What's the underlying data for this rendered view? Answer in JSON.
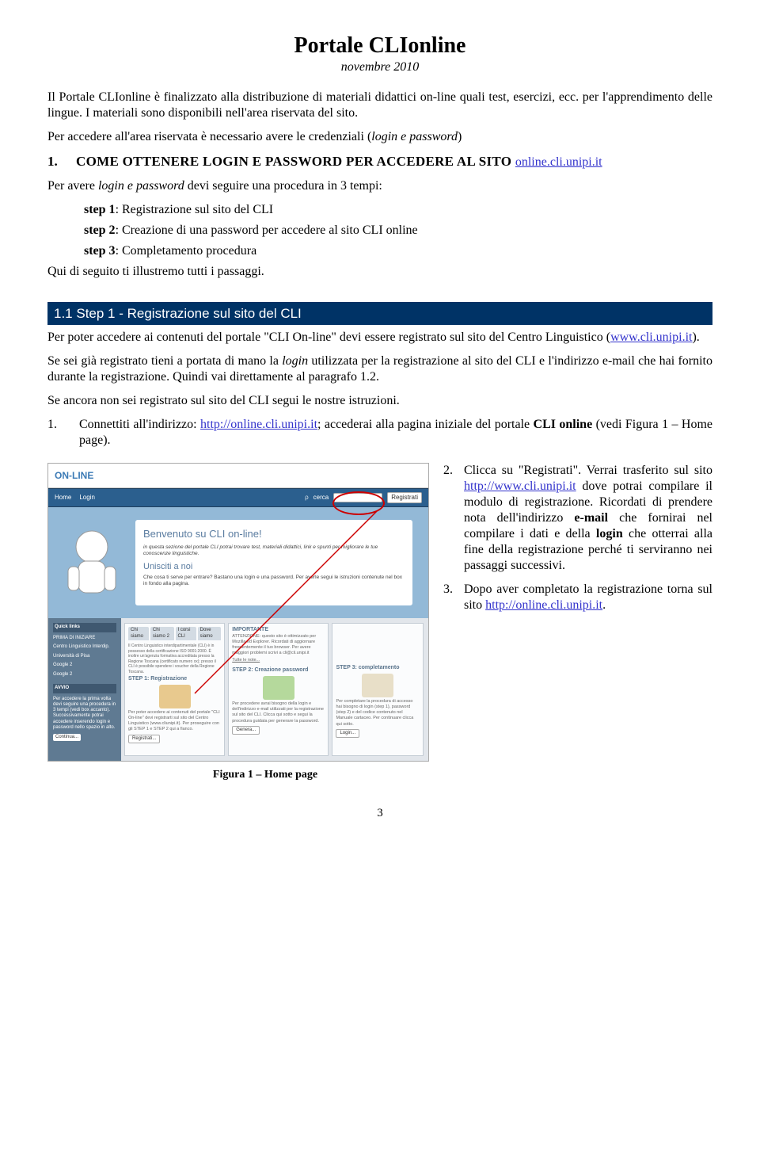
{
  "title": "Portale CLIonline",
  "subtitle": "novembre 2010",
  "intro_p1a": "Il Portale CLIonline è finalizzato alla distribuzione di materiali didattici on-line quali test, esercizi, ecc. per l'apprendimento delle lingue. I materiali sono disponibili nell'area riservata del sito.",
  "intro_p2a": "Per accedere all'area riservata è necessario avere le credenziali (",
  "intro_p2b": "login e password",
  "intro_p2c": ")",
  "sec1_num": "1.",
  "sec1_title": "COME OTTENERE LOGIN E PASSWORD PER ACCEDERE AL SITO ",
  "sec1_link": "online.cli.unipi.it",
  "procintro_a": "Per avere ",
  "procintro_b": "login e password",
  "procintro_c": " devi seguire una procedura in 3 tempi:",
  "step1_a": "step 1",
  "step1_b": ": Registrazione sul sito del CLI",
  "step2_a": "step 2",
  "step2_b": ": Creazione di una password per accedere al sito CLI online",
  "step3_a": "step 3",
  "step3_b": ": Completamento procedura",
  "procoutro": "Qui di seguito ti illustremo tutti i passaggi.",
  "bar11": "1.1 Step 1 - Registrazione sul sito del CLI",
  "p11_a": "Per poter accedere ai contenuti del portale \"CLI On-line\" devi essere registrato sul sito del Centro Linguistico (",
  "p11_link": "www.cli.unipi.it",
  "p11_b": ").",
  "p12_a": "Se sei già registrato tieni a portata di mano la ",
  "p12_b": "login",
  "p12_c": " utilizzata per la registrazione al sito del CLI e l'indirizzo e-mail che hai fornito durante la registrazione. Quindi vai direttamente al paragrafo 1.2.",
  "p13": "Se ancora non sei registrato sul sito del CLI segui le nostre istruzioni.",
  "li1_n": "1.",
  "li1_a": "Connettiti all'indirizzo: ",
  "li1_link": "http://online.cli.unipi.it",
  "li1_b": "; accederai alla pagina iniziale del portale ",
  "li1_c": "CLI online",
  "li1_d": " (vedi Figura 1 – Home page).",
  "li2_n": "2.",
  "li2_a": "Clicca su \"Registrati\". Verrai trasferito sul sito ",
  "li2_link": "http://www.cli.unipi.it",
  "li2_b": " dove potrai compilare il modulo di registrazione. Ricordati di prendere nota dell'indirizzo ",
  "li2_c": "e-mail",
  "li2_d": " che fornirai nel compilare i dati e della ",
  "li2_e": "login",
  "li2_f": " che otterrai alla fine della registrazione perché ti serviranno nei passaggi successivi.",
  "li3_n": "3.",
  "li3_a": "Dopo aver completato la registrazione torna sul sito ",
  "li3_link": "http://online.cli.unipi.it",
  "li3_b": ".",
  "figcap": "Figura 1 – Home page",
  "pagenum": "3",
  "ss": {
    "logo": "ON-LINE",
    "home": "Home",
    "login": "Login",
    "registrati": "Registrati",
    "cerca": "cerca",
    "hero_h1": "Benvenuto su CLI on-line!",
    "hero_p1": "in questa sezione del portale CLI potrai trovare test, materiali didattici, link e spunti per migliorare le tue conoscenze linguistiche.",
    "hero_h2": "Unisciti a noi",
    "hero_p2": "Che cosa ti serve per entrare? Bastano una login e una password. Per averle segui le istruzioni contenute nel box in fondo alla pagina.",
    "ql": "Quick links",
    "ql1": "PRIMA DI INIZIARE",
    "ql2": "Centro Linguistico Interdip.",
    "ql3": "Università di Pisa",
    "ql4": "Google 2",
    "avvio": "AVVIO",
    "avvio_t": "Per accedere la prima volta devi seguire una procedura in 3 tempi (vedi box accanto). Successivamente potrai accedere inserendo login e password nello spazio in alto.",
    "cont": "Continua...",
    "tabs1": "Chi siamo",
    "tabs2": "Chi siamo 2",
    "tabs3": "I corsi CLI",
    "tabs4": "Dove siamo",
    "s1t": "STEP 1: Registrazione",
    "s1b": "Per poter accedere ai contenuti del portale \"CLI On-line\" devi registrarti sul sito del Centro Linguistico (www.cliunipi.it). Per proseguire con gli STEP 1 e STEP 2 qui a fianco.",
    "s1btn": "Registrati...",
    "s2t": "STEP 2: Creazione password",
    "s2b": "Per procedere avrai bisogno della login e dell'indirizzo e-mail utilizzati per la registrazione sul sito del CLI. Clicca qui sotto e segui la procedura guidata per generare la password.",
    "s2btn": "Genera...",
    "s3t": "STEP 3: completamento",
    "s3b": "Per completare la procedura di accesso hai bisogno di login (step 1), password (step 2) e del codice contenuto nel Manuale cartaceo. Per continuare clicca qui sotto.",
    "s3btn": "Login...",
    "imp": "IMPORTANTE",
    "impb": "ATTENZIONE: questo sito è ottimizzato per Mozilla ed Explorer. Ricordati di aggiornare frequentemente il tuo browser. Per avere maggiori problemi scrivi a cli@cli.unipi.it",
    "tutto": "Tutte le note..."
  }
}
